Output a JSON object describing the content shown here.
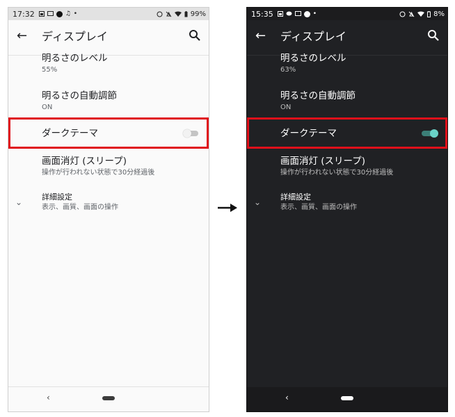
{
  "arrow_icon": "right-arrow-icon",
  "light": {
    "status": {
      "time": "17:32",
      "music": "♫",
      "dot_small": "•",
      "battery": "99%"
    },
    "appbar": {
      "back": "←",
      "title": "ディスプレイ"
    },
    "brightness": {
      "title": "明るさのレベル",
      "value": "55%"
    },
    "adaptive": {
      "title": "明るさの自動調節",
      "value": "ON"
    },
    "dark_theme": {
      "title": "ダークテーマ",
      "enabled": false
    },
    "sleep": {
      "title": "画面消灯 (スリープ)",
      "value": "操作が行われない状態で30分経過後"
    },
    "advanced": {
      "title": "詳細設定",
      "value": "表示、画質、画面の操作",
      "chevron": "⌄"
    },
    "nav": {
      "back": "‹"
    }
  },
  "dark": {
    "status": {
      "time": "15:35",
      "dot_small": "•",
      "battery": "8%"
    },
    "appbar": {
      "back": "←",
      "title": "ディスプレイ"
    },
    "brightness": {
      "title": "明るさのレベル",
      "value": "63%"
    },
    "adaptive": {
      "title": "明るさの自動調節",
      "value": "ON"
    },
    "dark_theme": {
      "title": "ダークテーマ",
      "enabled": true
    },
    "sleep": {
      "title": "画面消灯 (スリープ)",
      "value": "操作が行われない状態で30分経過後"
    },
    "advanced": {
      "title": "詳細設定",
      "value": "表示、画質、画面の操作",
      "chevron": "⌄"
    },
    "nav": {
      "back": "‹"
    }
  },
  "colors": {
    "highlight": "#e0101a",
    "toggle_on": "#6ad3c8",
    "dark_bg": "#202124"
  }
}
